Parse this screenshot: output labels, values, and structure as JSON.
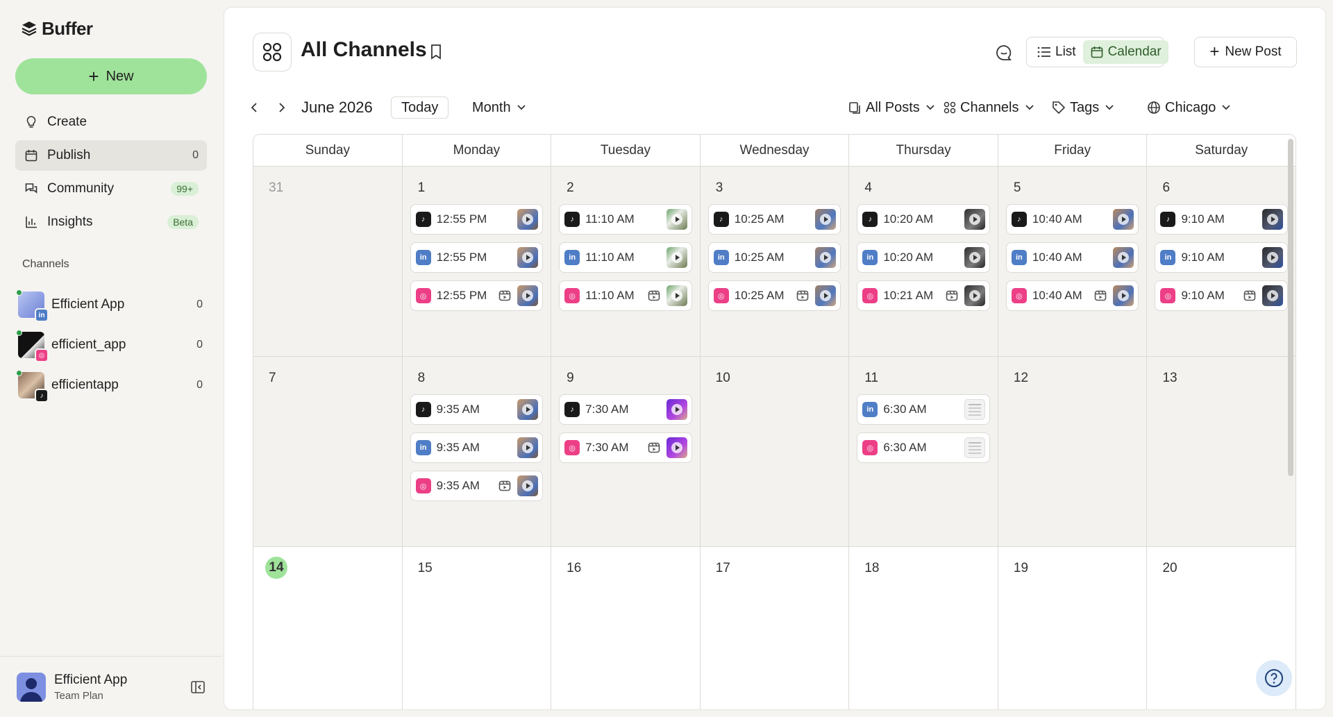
{
  "app": {
    "name": "Buffer"
  },
  "sidebar": {
    "new_label": "New",
    "nav": [
      {
        "label": "Create",
        "icon": "lightbulb-icon",
        "count": ""
      },
      {
        "label": "Publish",
        "icon": "calendar-icon",
        "count": "0"
      },
      {
        "label": "Community",
        "icon": "chat-icon",
        "count": "99+"
      },
      {
        "label": "Insights",
        "icon": "bar-chart-icon",
        "count": "Beta"
      }
    ],
    "channels_title": "Channels",
    "channels": [
      {
        "name": "Efficient App",
        "network": "linkedin",
        "count": "0"
      },
      {
        "name": "efficient_app",
        "network": "instagram",
        "count": "0"
      },
      {
        "name": "efficientapp",
        "network": "tiktok",
        "count": "0"
      }
    ],
    "user": {
      "name": "Efficient App",
      "plan": "Team Plan"
    }
  },
  "header": {
    "title": "All Channels",
    "view_list": "List",
    "view_calendar": "Calendar",
    "new_post": "New Post"
  },
  "toolbar": {
    "month": "June 2026",
    "today": "Today",
    "range": "Month",
    "filter_posts": "All Posts",
    "filter_channels": "Channels",
    "filter_tags": "Tags",
    "timezone": "Chicago"
  },
  "calendar": {
    "weekdays": [
      "Sunday",
      "Monday",
      "Tuesday",
      "Wednesday",
      "Thursday",
      "Friday",
      "Saturday"
    ],
    "weeks": [
      [
        {
          "day": "31",
          "muted": true,
          "posts": []
        },
        {
          "day": "1",
          "posts": [
            {
              "net": "tiktok",
              "time": "12:55 PM",
              "thumb": "t-a"
            },
            {
              "net": "linkedin",
              "time": "12:55 PM",
              "thumb": "t-a"
            },
            {
              "net": "instagram",
              "time": "12:55 PM",
              "thumb": "t-a",
              "reel": true
            }
          ]
        },
        {
          "day": "2",
          "posts": [
            {
              "net": "tiktok",
              "time": "11:10 AM",
              "thumb": "t-b"
            },
            {
              "net": "linkedin",
              "time": "11:10 AM",
              "thumb": "t-b"
            },
            {
              "net": "instagram",
              "time": "11:10 AM",
              "thumb": "t-b",
              "reel": true
            }
          ]
        },
        {
          "day": "3",
          "posts": [
            {
              "net": "tiktok",
              "time": "10:25 AM",
              "thumb": "t-c"
            },
            {
              "net": "linkedin",
              "time": "10:25 AM",
              "thumb": "t-c"
            },
            {
              "net": "instagram",
              "time": "10:25 AM",
              "thumb": "t-c",
              "reel": true
            }
          ]
        },
        {
          "day": "4",
          "posts": [
            {
              "net": "tiktok",
              "time": "10:20 AM",
              "thumb": "t-d"
            },
            {
              "net": "linkedin",
              "time": "10:20 AM",
              "thumb": "t-d"
            },
            {
              "net": "instagram",
              "time": "10:21 AM",
              "thumb": "t-d",
              "reel": true
            }
          ]
        },
        {
          "day": "5",
          "posts": [
            {
              "net": "tiktok",
              "time": "10:40 AM",
              "thumb": "t-e"
            },
            {
              "net": "linkedin",
              "time": "10:40 AM",
              "thumb": "t-e"
            },
            {
              "net": "instagram",
              "time": "10:40 AM",
              "thumb": "t-e",
              "reel": true
            }
          ]
        },
        {
          "day": "6",
          "posts": [
            {
              "net": "tiktok",
              "time": "9:10 AM",
              "thumb": "t-f"
            },
            {
              "net": "linkedin",
              "time": "9:10 AM",
              "thumb": "t-f"
            },
            {
              "net": "instagram",
              "time": "9:10 AM",
              "thumb": "t-f",
              "reel": true
            }
          ]
        }
      ],
      [
        {
          "day": "7",
          "posts": []
        },
        {
          "day": "8",
          "posts": [
            {
              "net": "tiktok",
              "time": "9:35 AM",
              "thumb": "t-a"
            },
            {
              "net": "linkedin",
              "time": "9:35 AM",
              "thumb": "t-a"
            },
            {
              "net": "instagram",
              "time": "9:35 AM",
              "thumb": "t-a",
              "reel": true
            }
          ]
        },
        {
          "day": "9",
          "posts": [
            {
              "net": "tiktok",
              "time": "7:30 AM",
              "thumb": "t-g"
            },
            {
              "net": "instagram",
              "time": "7:30 AM",
              "thumb": "t-g",
              "reel": true
            }
          ]
        },
        {
          "day": "10",
          "posts": []
        },
        {
          "day": "11",
          "posts": [
            {
              "net": "linkedin",
              "time": "6:30 AM",
              "thumb": "t-h"
            },
            {
              "net": "instagram",
              "time": "6:30 AM",
              "thumb": "t-h"
            }
          ]
        },
        {
          "day": "12",
          "posts": []
        },
        {
          "day": "13",
          "posts": []
        }
      ],
      [
        {
          "day": "14",
          "today": true,
          "posts": []
        },
        {
          "day": "15",
          "posts": []
        },
        {
          "day": "16",
          "posts": []
        },
        {
          "day": "17",
          "posts": []
        },
        {
          "day": "18",
          "posts": []
        },
        {
          "day": "19",
          "posts": []
        },
        {
          "day": "20",
          "posts": []
        }
      ]
    ]
  },
  "colors": {
    "accent": "#9fe39a",
    "linkedin": "#4f7dc6",
    "instagram": "#ec3f86",
    "tiktok": "#1a1a1a"
  }
}
